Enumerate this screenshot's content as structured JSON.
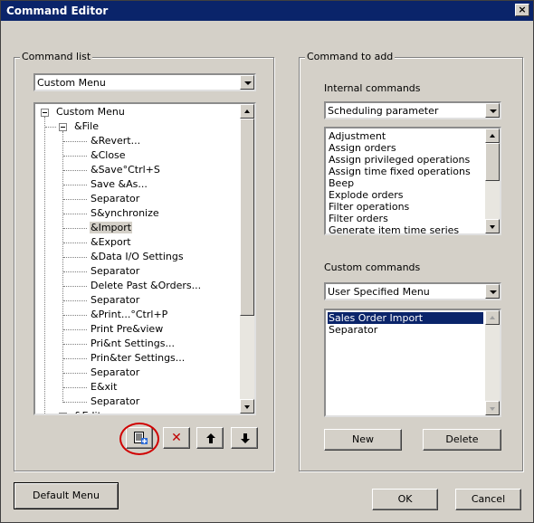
{
  "window": {
    "title": "Command Editor",
    "close_glyph": "×"
  },
  "command_list": {
    "legend": "Command list",
    "menu_combo": {
      "value": "Custom Menu"
    },
    "tree": {
      "root": "Custom Menu",
      "file_node": "&File",
      "file_children": [
        "&Revert...",
        "&Close",
        "&Save°Ctrl+S",
        "Save &As...",
        "Separator",
        "S&ynchronize",
        "&Import",
        "&Export",
        "&Data I/O Settings",
        "Separator",
        "Delete Past &Orders...",
        "Separator",
        "&Print...°Ctrl+P",
        "Print Pre&view",
        "Pri&nt Settings...",
        "Prin&ter Settings...",
        "Separator",
        "E&xit",
        "Separator"
      ],
      "next_node": "&Edit",
      "selected_item": "&Import"
    },
    "buttons": {
      "add_icon": "add-to-menu-icon",
      "delete_glyph": "✕",
      "up_glyph": "🡅",
      "down_glyph": "🡇"
    }
  },
  "command_to_add": {
    "legend": "Command to add",
    "internal": {
      "label": "Internal commands",
      "combo_value": "Scheduling parameter",
      "items": [
        "Adjustment",
        "Assign orders",
        "Assign privileged operations",
        "Assign time fixed operations",
        "Beep",
        "Explode orders",
        "Filter operations",
        "Filter orders",
        "Generate item time series"
      ]
    },
    "custom": {
      "label": "Custom commands",
      "combo_value": "User Specified Menu",
      "items": [
        "Sales Order Import",
        "Separator"
      ],
      "selected": "Sales Order Import",
      "new_label": "New",
      "delete_label": "Delete"
    }
  },
  "footer": {
    "default_menu_label": "Default Menu",
    "ok_label": "OK",
    "cancel_label": "Cancel"
  },
  "colors": {
    "title_bar": "#0a246a",
    "selection": "#0a246a",
    "highlight_circle": "#d00000",
    "delete_x": "#c00000"
  }
}
